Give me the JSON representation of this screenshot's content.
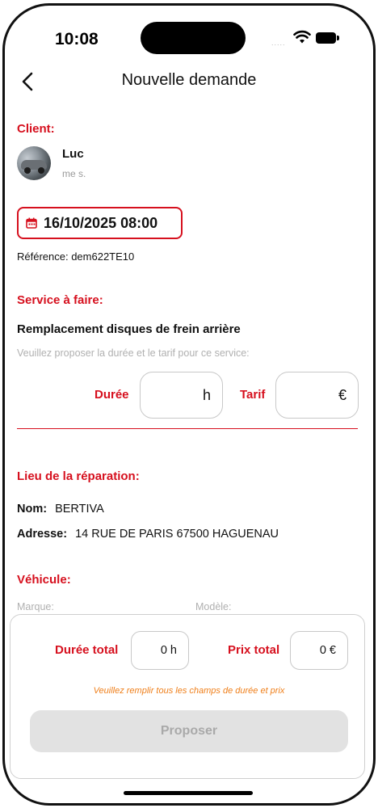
{
  "status_bar": {
    "time": "10:08",
    "signal": "....."
  },
  "header": {
    "title": "Nouvelle demande"
  },
  "client": {
    "section_label": "Client:",
    "name": "Luc",
    "subtitle": "me s."
  },
  "appointment": {
    "datetime": "16/10/2025 08:00",
    "reference": "Référence: dem622TE10"
  },
  "service": {
    "section_label": "Service à faire:",
    "name": "Remplacement disques de frein arrière",
    "hint": "Veuillez proposer la durée et le tarif pour ce service:",
    "duration_label": "Durée",
    "duration_unit": "h",
    "price_label": "Tarif",
    "price_unit": "€"
  },
  "location": {
    "section_label": "Lieu de la réparation:",
    "name_label": "Nom:",
    "name_value": "BERTIVA",
    "address_label": "Adresse:",
    "address_value": "14 RUE DE PARIS 67500 HAGUENAU"
  },
  "vehicle": {
    "section_label": "Véhicule:",
    "brand_label": "Marque:",
    "model_label": "Modèle:"
  },
  "totals": {
    "duration_label": "Durée total",
    "duration_value": "0 h",
    "price_label": "Prix total",
    "price_value": "0 €",
    "warning": "Veuillez remplir tous les champs de durée et prix",
    "submit_label": "Proposer"
  },
  "colors": {
    "accent": "#d6101e",
    "warning": "#ef7f1a",
    "disabled_button": "#e2e2e2"
  },
  "icons": [
    "back-chevron-icon",
    "calendar-icon",
    "wifi-icon",
    "battery-icon"
  ]
}
